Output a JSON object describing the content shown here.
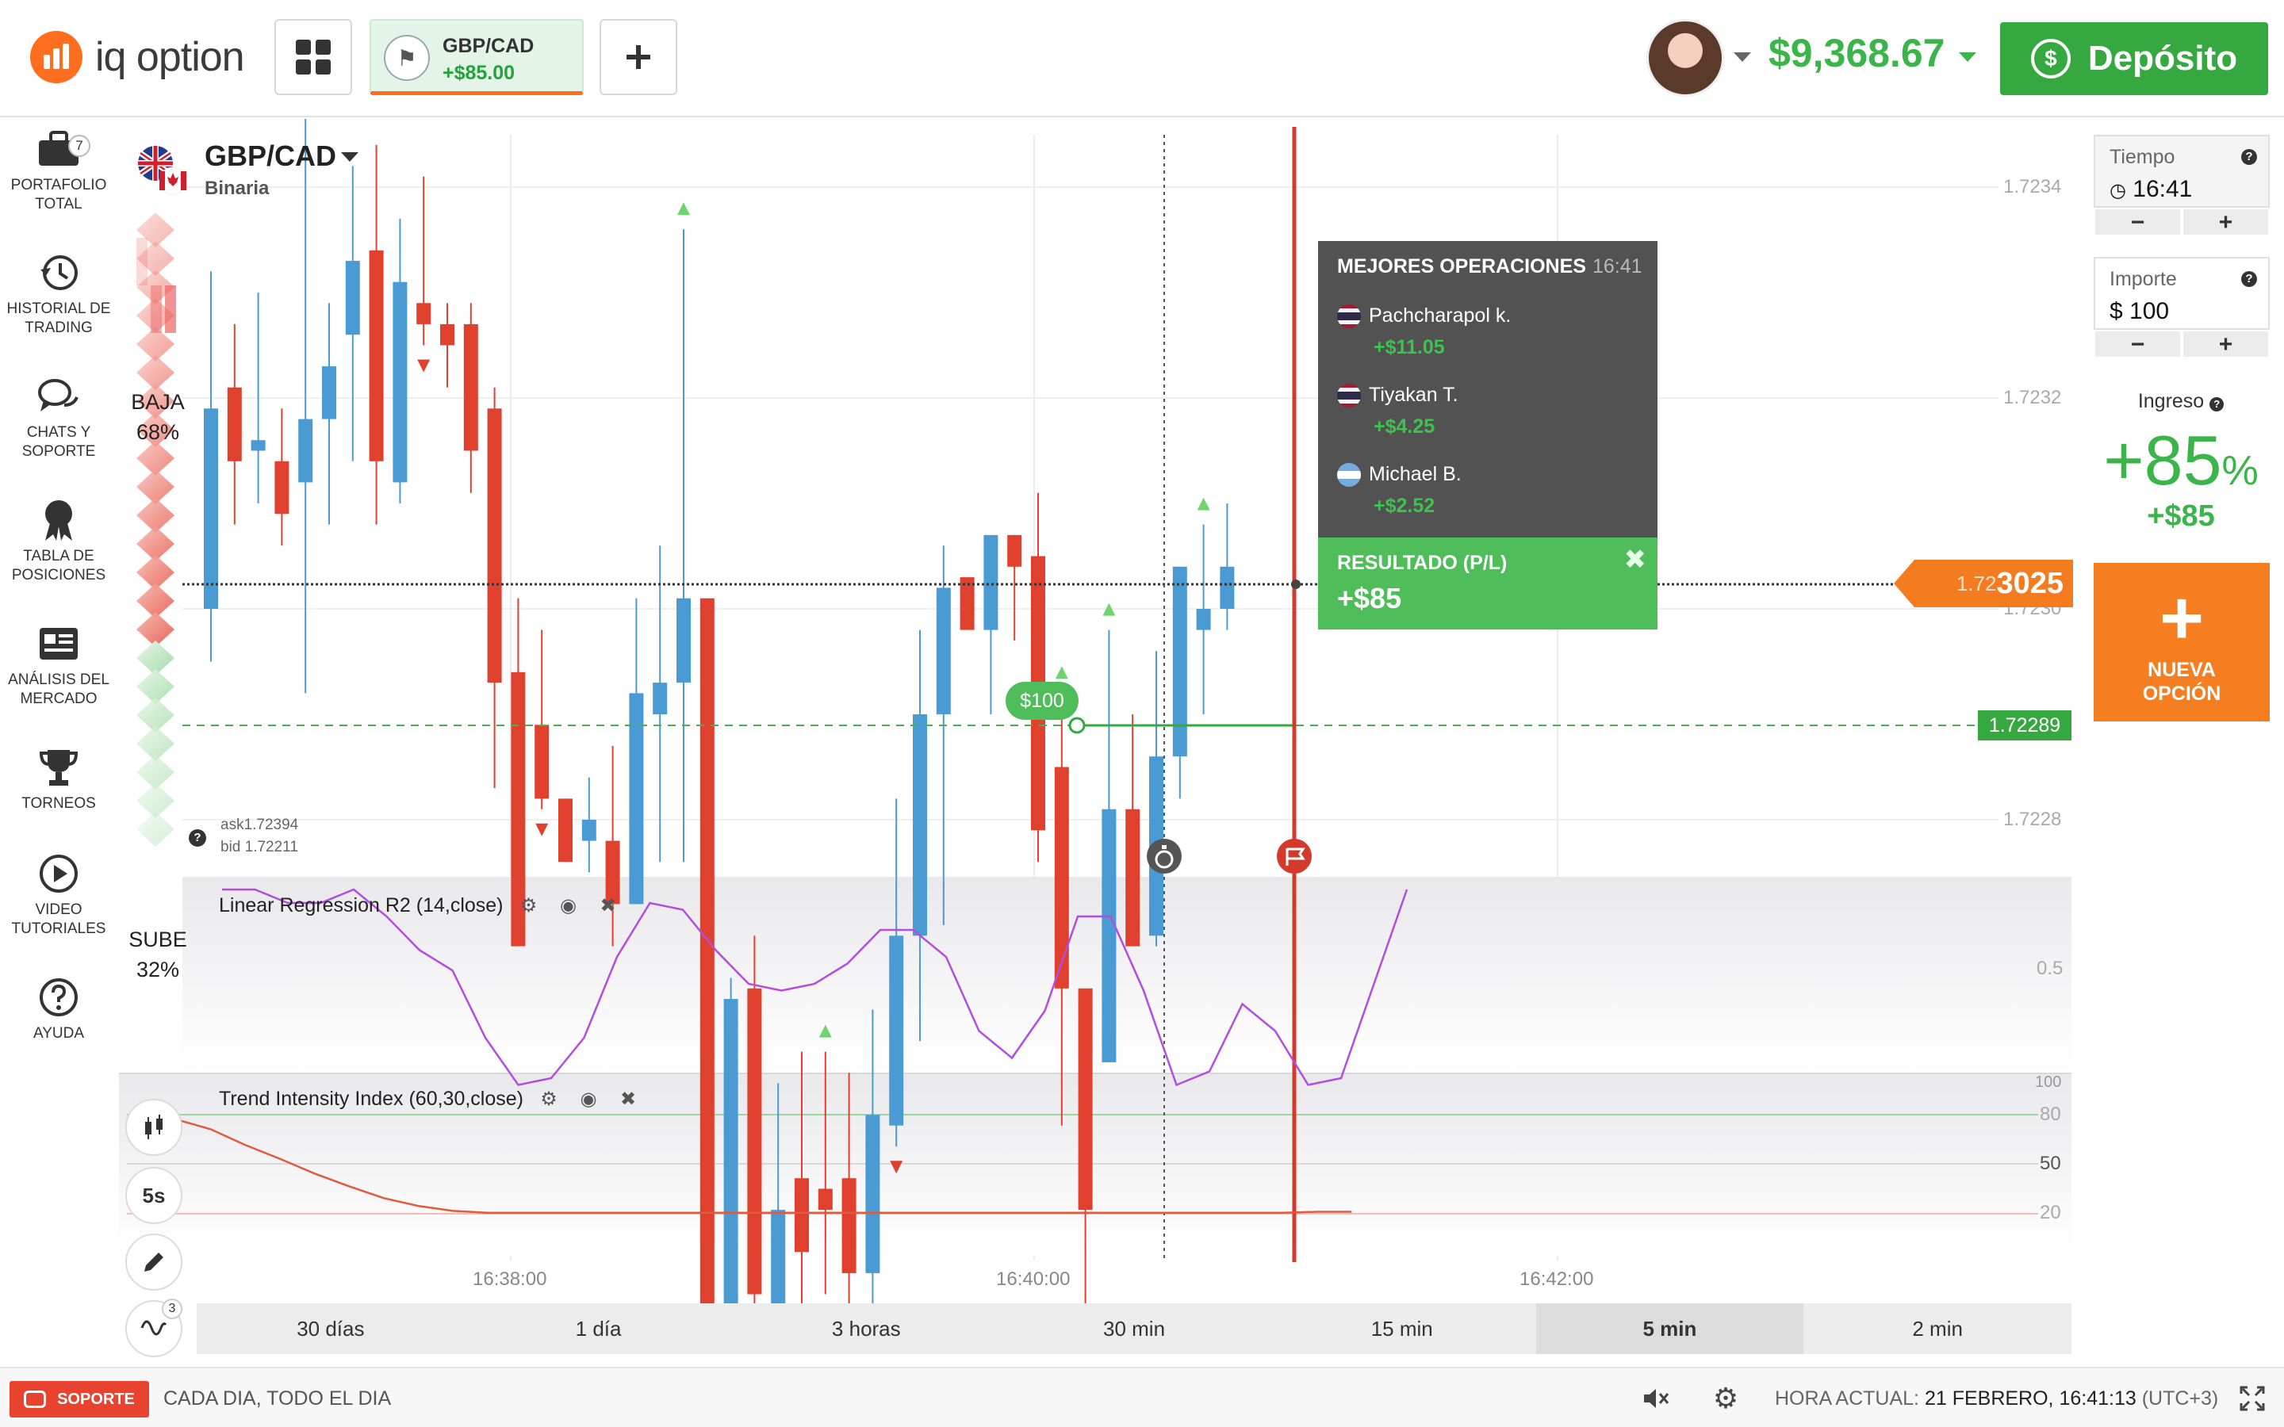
{
  "app": {
    "logo_text": "iq option",
    "tab": {
      "symbol": "GBP/CAD",
      "pnl": "+$85.00"
    },
    "balance": "$9,368.67",
    "deposit_label": "Depósito",
    "colors": {
      "green": "#35a83f",
      "orange": "#f47b20",
      "red": "#e8432f",
      "blue": "#4a9ad4"
    }
  },
  "sidebar": {
    "items": [
      {
        "label1": "PORTAFOLIO",
        "label2": "TOTAL",
        "icon": "briefcase-icon",
        "badge": "7"
      },
      {
        "label1": "HISTORIAL DE",
        "label2": "TRADING",
        "icon": "history-icon"
      },
      {
        "label1": "CHATS Y",
        "label2": "SOPORTE",
        "icon": "chat-icon"
      },
      {
        "label1": "TABLA DE",
        "label2": "POSICIONES",
        "icon": "medal-icon"
      },
      {
        "label1": "ANÁLISIS DEL",
        "label2": "MERCADO",
        "icon": "news-icon"
      },
      {
        "label1": "TORNEOS",
        "label2": "",
        "icon": "trophy-icon"
      },
      {
        "label1": "VIDEO",
        "label2": "TUTORIALES",
        "icon": "play-icon"
      },
      {
        "label1": "AYUDA",
        "label2": "",
        "icon": "help-icon"
      }
    ]
  },
  "asset": {
    "name": "GBP/CAD",
    "type": "Binaria"
  },
  "sentiment": {
    "down_label": "BAJA",
    "down_pct": "68%",
    "up_label": "SUBE",
    "up_pct": "32%"
  },
  "quote": {
    "ask": "ask1.72394",
    "bid": "bid 1.72211"
  },
  "best_trades": {
    "title": "MEJORES OPERACIONES",
    "time": "16:41",
    "traders": [
      {
        "name": "Pachcharapol k.",
        "amount": "+$11.05",
        "flag": "thailand"
      },
      {
        "name": "Tiyakan T.",
        "amount": "+$4.25",
        "flag": "thailand"
      },
      {
        "name": "Michael B.",
        "amount": "+$2.52",
        "flag": "argentina"
      }
    ]
  },
  "result": {
    "label": "RESULTADO (P/L)",
    "value": "+$85"
  },
  "prices": {
    "current_prefix": "1.72",
    "current_suffix": "3025",
    "strike": "1.72289",
    "investment": "$100"
  },
  "chart_data": {
    "type": "candlestick",
    "y_ticks": [
      "1.7234",
      "1.7232",
      "1.7230",
      "1.7228"
    ],
    "x_ticks": [
      "16:38:00",
      "16:40:00",
      "16:42:00"
    ],
    "current_price": 1.723025,
    "strike_price": 1.72289,
    "ohlc": [
      [
        1.723,
        1.72332,
        1.72295,
        1.72319
      ],
      [
        1.72321,
        1.72327,
        1.72308,
        1.72314
      ],
      [
        1.72315,
        1.7233,
        1.7231,
        1.72316
      ],
      [
        1.72314,
        1.72319,
        1.72306,
        1.72309
      ],
      [
        1.72312,
        1.72352,
        1.72292,
        1.72318
      ],
      [
        1.72318,
        1.72329,
        1.72308,
        1.72323
      ],
      [
        1.72326,
        1.72342,
        1.72314,
        1.72333
      ],
      [
        1.72334,
        1.72344,
        1.72308,
        1.72314
      ],
      [
        1.72312,
        1.72337,
        1.7231,
        1.72331
      ],
      [
        1.72329,
        1.72341,
        1.72325,
        1.72327
      ],
      [
        1.72327,
        1.72329,
        1.72321,
        1.72325
      ],
      [
        1.72327,
        1.72329,
        1.72311,
        1.72315
      ],
      [
        1.72319,
        1.72321,
        1.72283,
        1.72293
      ],
      [
        1.72294,
        1.72301,
        1.7227,
        1.72268
      ],
      [
        1.72289,
        1.72298,
        1.72281,
        1.72282
      ],
      [
        1.72282,
        1.72282,
        1.72276,
        1.72276
      ],
      [
        1.72278,
        1.72284,
        1.72275,
        1.7228
      ],
      [
        1.72278,
        1.72287,
        1.72268,
        1.72272
      ],
      [
        1.72272,
        1.72301,
        1.72278,
        1.72292
      ],
      [
        1.7229,
        1.72306,
        1.72276,
        1.72293
      ],
      [
        1.72293,
        1.72336,
        1.72276,
        1.72301
      ],
      [
        1.72301,
        1.723,
        1.72216,
        1.72225
      ],
      [
        1.72225,
        1.72265,
        1.72216,
        1.72263
      ],
      [
        1.72264,
        1.72269,
        1.72225,
        1.72235
      ],
      [
        1.72231,
        1.72255,
        1.72224,
        1.72243
      ],
      [
        1.72246,
        1.72258,
        1.72233,
        1.72239
      ],
      [
        1.72245,
        1.72258,
        1.72235,
        1.72243
      ],
      [
        1.72246,
        1.72256,
        1.72232,
        1.72237
      ],
      [
        1.72237,
        1.72262,
        1.72232,
        1.72252
      ],
      [
        1.72251,
        1.72282,
        1.72249,
        1.72269
      ],
      [
        1.72269,
        1.72298,
        1.72259,
        1.7229
      ],
      [
        1.7229,
        1.72306,
        1.7227,
        1.72302
      ],
      [
        1.72303,
        1.72297,
        1.72297,
        1.72298
      ],
      [
        1.72298,
        1.72306,
        1.7229,
        1.72307
      ],
      [
        1.72307,
        1.72307,
        1.72297,
        1.72304
      ],
      [
        1.72305,
        1.72311,
        1.72276,
        1.72279
      ],
      [
        1.72285,
        1.72292,
        1.72251,
        1.72264
      ],
      [
        1.72264,
        1.72262,
        1.72232,
        1.72243
      ],
      [
        1.72257,
        1.72298,
        1.72257,
        1.72281
      ],
      [
        1.72281,
        1.7229,
        1.72268,
        1.72268
      ],
      [
        1.72269,
        1.72296,
        1.72268,
        1.72286
      ],
      [
        1.72286,
        1.72304,
        1.72282,
        1.72304
      ],
      [
        1.72298,
        1.72308,
        1.7229,
        1.723
      ],
      [
        1.723,
        1.7231,
        1.72298,
        1.72304
      ]
    ],
    "arrows_up_idx": [
      20,
      26,
      36,
      38,
      42
    ],
    "arrows_down_idx": [
      9,
      14,
      25,
      29,
      37,
      44,
      46
    ]
  },
  "indicators": [
    {
      "title": "Linear Regression R2 (14,close)",
      "y_ticks": [
        "0.5"
      ],
      "values": [
        0.62,
        0.62,
        0.6,
        0.6,
        0.62,
        0.58,
        0.53,
        0.5,
        0.4,
        0.33,
        0.34,
        0.4,
        0.52,
        0.6,
        0.59,
        0.53,
        0.48,
        0.47,
        0.48,
        0.51,
        0.56,
        0.56,
        0.52,
        0.41,
        0.37,
        0.44,
        0.58,
        0.58,
        0.47,
        0.33,
        0.35,
        0.45,
        0.41,
        0.33,
        0.34,
        0.48,
        0.62
      ]
    },
    {
      "title": "Trend Intensity Index (60,30,close)",
      "y_ticks": [
        "100",
        "80",
        "50",
        "20"
      ],
      "values": [
        100,
        90,
        74,
        60,
        45,
        32,
        20,
        12,
        7,
        5,
        5,
        5,
        5,
        5,
        5,
        5,
        5,
        5,
        5,
        5,
        5,
        5,
        5,
        5,
        5,
        5,
        5,
        5,
        5,
        5,
        5,
        5,
        5,
        6,
        6
      ]
    }
  ],
  "tools": [
    {
      "label": "",
      "badge": ""
    },
    {
      "label": "5s",
      "badge": ""
    },
    {
      "label": "",
      "badge": ""
    },
    {
      "label": "",
      "badge": "3"
    }
  ],
  "timeframes": [
    "30 días",
    "1 día",
    "3 horas",
    "30 min",
    "15 min",
    "5 min",
    "2 min"
  ],
  "timeframe_selected": "5 min",
  "right_panel": {
    "time_label": "Tiempo",
    "time_value": "16:41",
    "amount_label": "Importe",
    "amount_value": "$ 100",
    "minus": "−",
    "plus": "+",
    "income_label": "Ingreso",
    "income_pct": "+85",
    "pct_sign": "%",
    "income_amt": "+$85",
    "new_option": "NUEVA",
    "new_option2": "OPCIÓN"
  },
  "footer": {
    "support": "SOPORTE",
    "tagline": "CADA DIA, TODO EL DIA",
    "clock_label": "HORA ACTUAL:",
    "clock_value": "21 FEBRERO, 16:41:13",
    "tz": "(UTC+3)"
  }
}
